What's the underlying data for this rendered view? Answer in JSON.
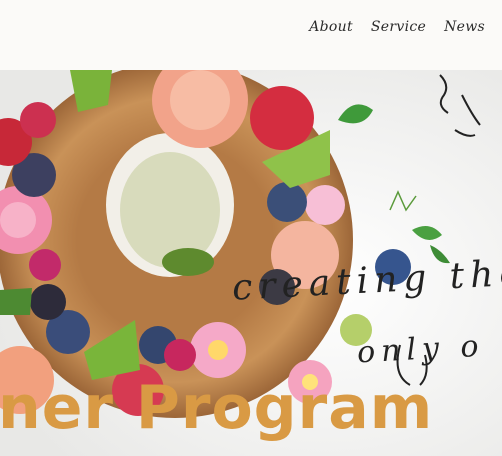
{
  "nav": {
    "items": [
      "About",
      "Service",
      "News"
    ]
  },
  "hero": {
    "plate_line1": "creating the",
    "plate_line2": "only o",
    "title": "ner Program"
  }
}
